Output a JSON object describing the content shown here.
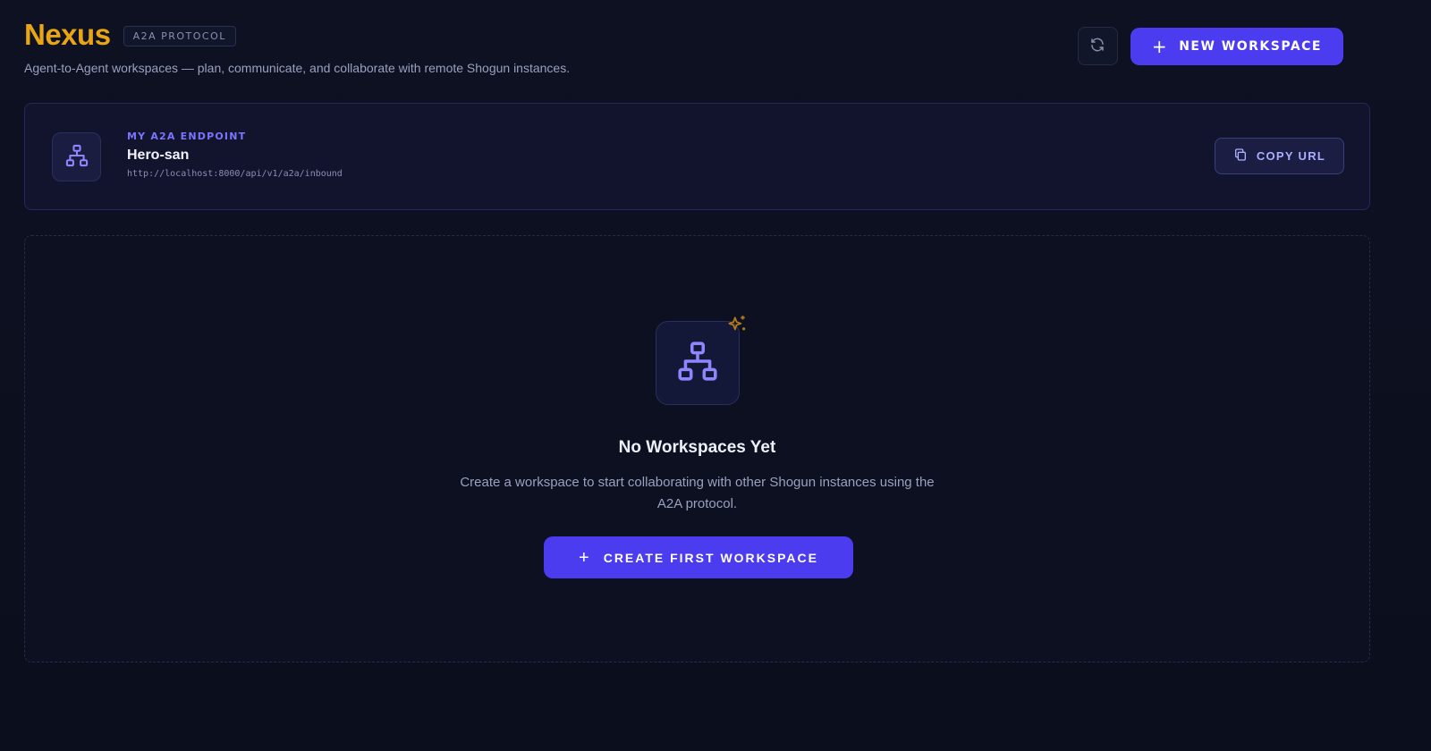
{
  "header": {
    "title": "Nexus",
    "badge": "A2A PROTOCOL",
    "subtitle": "Agent-to-Agent workspaces — plan, communicate, and collaborate with remote Shogun instances.",
    "refresh_icon": "refresh-icon",
    "new_workspace_label": "NEW WORKSPACE"
  },
  "endpoint": {
    "label": "MY A2A ENDPOINT",
    "name": "Hero-san",
    "url": "http://localhost:8000/api/v1/a2a/inbound",
    "icon": "network-icon",
    "copy_label": "COPY URL"
  },
  "empty_state": {
    "title": "No Workspaces Yet",
    "description": "Create a workspace to start collaborating with other Shogun instances using the A2A protocol.",
    "button_label": "CREATE FIRST WORKSPACE",
    "icon": "network-icon",
    "accent_icon": "sparkles-icon"
  },
  "colors": {
    "accent": "#4c3cf0",
    "title": "#e8a516",
    "label": "#7b74ff",
    "background": "#0b0e1d"
  }
}
